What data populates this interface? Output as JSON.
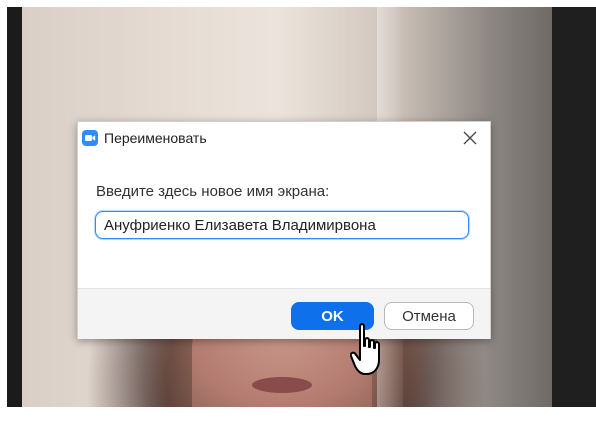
{
  "dialog": {
    "title": "Переименовать",
    "close_icon": "close-icon",
    "app_icon": "zoom-video-icon",
    "prompt": "Введите здесь новое имя экрана:",
    "name_value": "Ануфриенко Елизавета Владимирвона",
    "ok_label": "OK",
    "cancel_label": "Отмена"
  },
  "colors": {
    "accent": "#0e71eb",
    "input_focus": "#2d8cff",
    "footer_bg": "#f4f4f4"
  },
  "cursor": {
    "icon": "hand-pointer-cursor"
  }
}
